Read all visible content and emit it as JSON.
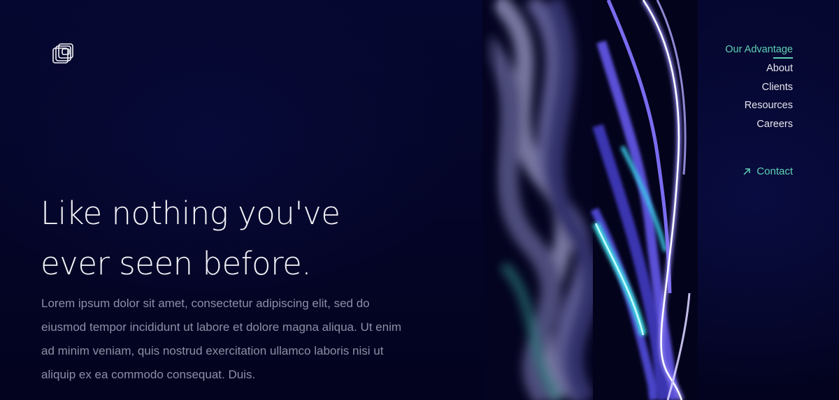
{
  "logo": {
    "icon": "stacked-squares-logo-icon"
  },
  "nav": {
    "items": [
      {
        "label": "Our Advantage",
        "active": true
      },
      {
        "label": "About",
        "active": false
      },
      {
        "label": "Clients",
        "active": false
      },
      {
        "label": "Resources",
        "active": false
      },
      {
        "label": "Careers",
        "active": false
      }
    ]
  },
  "contact": {
    "label": "Contact",
    "icon": "arrow-up-right-icon"
  },
  "hero": {
    "headline_line1": "Like nothing you've",
    "headline_line2": "ever seen before.",
    "body": "Lorem ipsum dolor sit amet, consectetur adipiscing elit, sed do eiusmod tempor incididunt ut labore et dolore magna aliqua. Ut enim ad minim veniam, quis nostrud exercitation ullamco laboris nisi ut aliquip ex ea commodo consequat. Duis."
  },
  "colors": {
    "background": "#03031f",
    "accent": "#5fd1b4",
    "nav_text": "#e6e6ee",
    "body_text": "#8e8ea6",
    "headline_text": "#f2f2f6"
  }
}
